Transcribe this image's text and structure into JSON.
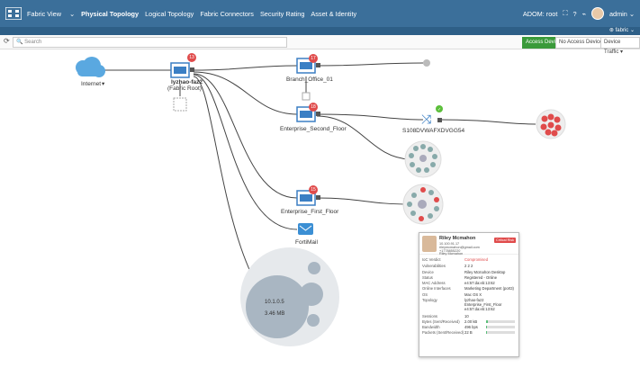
{
  "header": {
    "app_title": "Fabric View",
    "tabs": [
      "Physical Topology",
      "Logical Topology",
      "Fabric Connectors",
      "Security Rating",
      "Asset & Identity"
    ],
    "adom": "ADOM: root",
    "user": "admin"
  },
  "subbar": {
    "fabric": "fabric"
  },
  "toolbar": {
    "search_placeholder": "Search",
    "access_device": "Access Device",
    "no_access_device": "No Access Device",
    "device_traffic": "Device Traffic"
  },
  "nodes": {
    "internet": "Internet",
    "root_name": "lyzhao-faz2",
    "root_sub": "(Fabric Root)",
    "branch": "Branch_Office_01",
    "second_floor": "Enterprise_Second_Floor",
    "switch": "S108DVWAFXDVGG54",
    "first_floor": "Enterprise_First_Floor",
    "fortimail": "FortiMail",
    "bubble_ip": "10.1.0.5",
    "bubble_size": "3.46 MB"
  },
  "badges": {
    "root": "13",
    "branch": "17",
    "second": "18",
    "first": "15"
  },
  "popup": {
    "name": "Riley Mcmahon",
    "ip": "10.100.91.17",
    "email": "rileymcmahon@gmail.com",
    "phone": "+1778855220",
    "alias": "Riley Mcmahon",
    "risk": "Critical Risk",
    "rows": [
      {
        "k": "IoC Verdict",
        "v": "Compromised"
      },
      {
        "k": "Vulnerabilities",
        "v": "2 2 2"
      },
      {
        "k": "Device",
        "v": "Riley Mcmahon Desktop"
      },
      {
        "k": "Status",
        "v": "Registered - Online"
      },
      {
        "k": "MAC Address",
        "v": "e4:57:da:eb:13:62"
      },
      {
        "k": "Online Interfaces",
        "v": "Marketing Department (port3)"
      },
      {
        "k": "OS",
        "v": "Mac OS X"
      },
      {
        "k": "Topology",
        "v": "lyzhao-faz2"
      },
      {
        "k": "",
        "v": "Enterprise_First_Floor"
      },
      {
        "k": "",
        "v": "e4:57:da:eb:13:62"
      },
      {
        "k": "Sessions",
        "v": "10"
      },
      {
        "k": "Bytes (Sent/Received)",
        "v": "2.00 kB"
      },
      {
        "k": "Bandwidth",
        "v": "496 bps"
      },
      {
        "k": "Packets (Sent/Received)",
        "v": "22 B"
      }
    ],
    "bars": [
      0.05,
      0.03,
      0.04
    ],
    "colors": {
      "compromised": "#e04b4b",
      "registered": "#f0b429"
    }
  }
}
